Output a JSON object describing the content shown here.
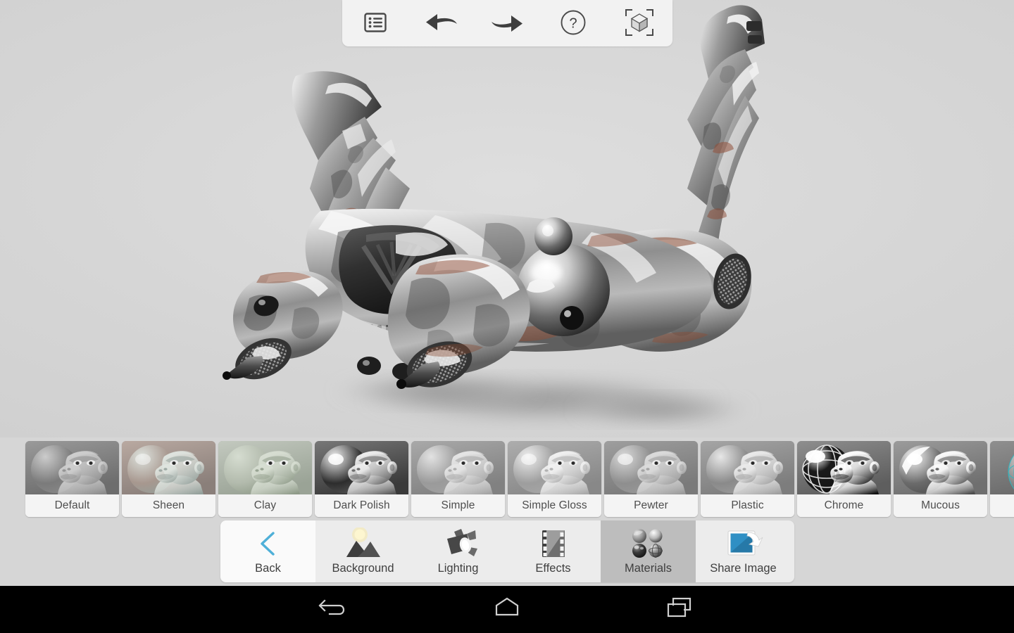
{
  "app": {
    "viewport_background_color": "#d7d7d7",
    "panel_color": "#f2f2f2",
    "accent_color": "#4fb0d8"
  },
  "toolbar": {
    "buttons": [
      {
        "name": "list-icon",
        "label": "Model List"
      },
      {
        "name": "undo-icon",
        "label": "Undo"
      },
      {
        "name": "redo-icon",
        "label": "Redo"
      },
      {
        "name": "help-icon",
        "label": "Help"
      },
      {
        "name": "cube-reset-icon",
        "label": "Reset View"
      }
    ]
  },
  "viewport": {
    "model_name": "Spaceship",
    "shading": "camouflage metal"
  },
  "materials": {
    "selected": "Default",
    "items": [
      {
        "label": "Default"
      },
      {
        "label": "Sheen"
      },
      {
        "label": "Clay"
      },
      {
        "label": "Dark Polish"
      },
      {
        "label": "Simple"
      },
      {
        "label": "Simple Gloss"
      },
      {
        "label": "Pewter"
      },
      {
        "label": "Plastic"
      },
      {
        "label": "Chrome"
      },
      {
        "label": "Mucous"
      },
      {
        "label": ""
      }
    ]
  },
  "bottom_nav": {
    "active": "Materials",
    "items": [
      {
        "label": "Back",
        "icon": "chevron-left-icon"
      },
      {
        "label": "Background",
        "icon": "landscape-icon"
      },
      {
        "label": "Lighting",
        "icon": "spotlight-icon"
      },
      {
        "label": "Effects",
        "icon": "filmstrip-icon"
      },
      {
        "label": "Materials",
        "icon": "material-spheres-icon"
      },
      {
        "label": "Share Image",
        "icon": "share-photo-icon"
      }
    ]
  },
  "system_bar": {
    "buttons": [
      {
        "label": "Back",
        "icon": "android-back-icon"
      },
      {
        "label": "Home",
        "icon": "android-home-icon"
      },
      {
        "label": "Recents",
        "icon": "android-recents-icon"
      }
    ]
  }
}
